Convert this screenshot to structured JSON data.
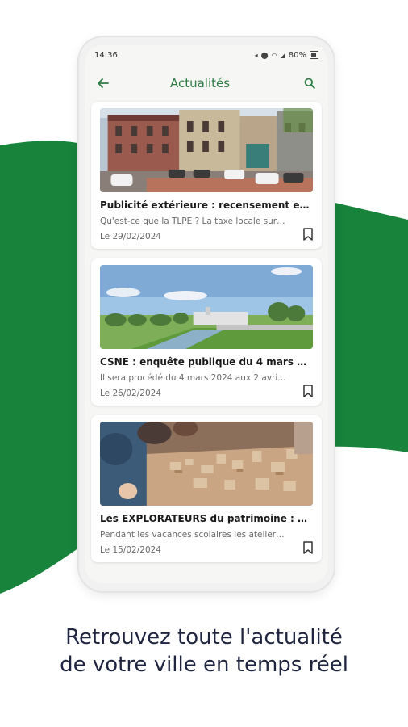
{
  "colors": {
    "accent": "#2e7d45",
    "brand_green": "#17833b",
    "caption_text": "#1f2440"
  },
  "status_bar": {
    "time": "14:36",
    "battery": "80%"
  },
  "app_bar": {
    "title": "Actualités",
    "back_icon": "arrow-left-icon",
    "search_icon": "search-icon"
  },
  "articles": [
    {
      "title": "Publicité extérieure : recensement e…",
      "excerpt": "Qu'est-ce que la TLPE ? La taxe locale sur…",
      "date": "Le 29/02/2024",
      "image": "town-square-photo",
      "bookmark_icon": "bookmark-icon"
    },
    {
      "title": "CSNE :  enquête publique du 4 mars …",
      "excerpt": "Il sera procédé du 4 mars 2024 aux 2 avri…",
      "date": "Le 26/02/2024",
      "image": "canal-landscape-photo",
      "bookmark_icon": "bookmark-icon"
    },
    {
      "title": "Les EXPLORATEURS du patrimoine : …",
      "excerpt": "Pendant les vacances scolaires les atelier…",
      "date": "Le 15/02/2024",
      "image": "children-model-workshop-photo",
      "bookmark_icon": "bookmark-icon"
    }
  ],
  "caption": {
    "line1": "Retrouvez toute l'actualité",
    "line2": "de votre ville en temps réel"
  }
}
